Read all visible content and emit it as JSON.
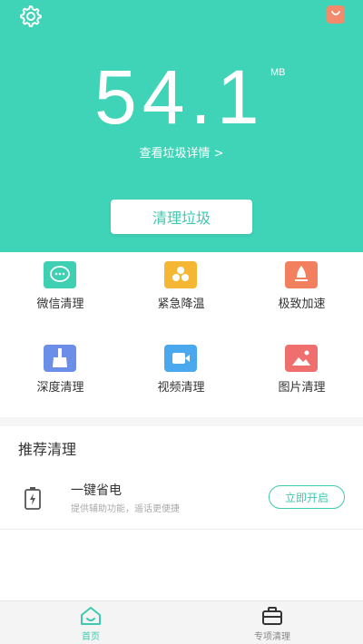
{
  "header": {
    "size_value": "54.1",
    "size_unit": "MB",
    "detail_link": "查看垃圾详情 >",
    "clean_button": "清理垃圾"
  },
  "grid": [
    {
      "label": "微信清理",
      "icon": "wechat-icon",
      "color": "#3fcfb3"
    },
    {
      "label": "紧急降温",
      "icon": "cooling-icon",
      "color": "#f5b733"
    },
    {
      "label": "极致加速",
      "icon": "rocket-icon",
      "color": "#f2805f"
    },
    {
      "label": "深度清理",
      "icon": "broom-icon",
      "color": "#6b8ee8"
    },
    {
      "label": "视频清理",
      "icon": "video-icon",
      "color": "#4aa8ee"
    },
    {
      "label": "图片清理",
      "icon": "image-icon",
      "color": "#ef6f6f"
    }
  ],
  "recommend": {
    "title": "推荐清理",
    "items": [
      {
        "title": "一键省电",
        "subtitle": "提供辅助功能，遥话更便捷",
        "button": "立即开启",
        "icon": "battery-icon"
      }
    ]
  },
  "tabs": [
    {
      "label": "首页",
      "icon": "home-icon",
      "active": true
    },
    {
      "label": "专项清理",
      "icon": "briefcase-icon",
      "active": false
    }
  ],
  "colors": {
    "accent": "#3fd4b8",
    "accent_text": "#3fc9ae",
    "text": "#333333",
    "muted": "#aaaaaa"
  }
}
